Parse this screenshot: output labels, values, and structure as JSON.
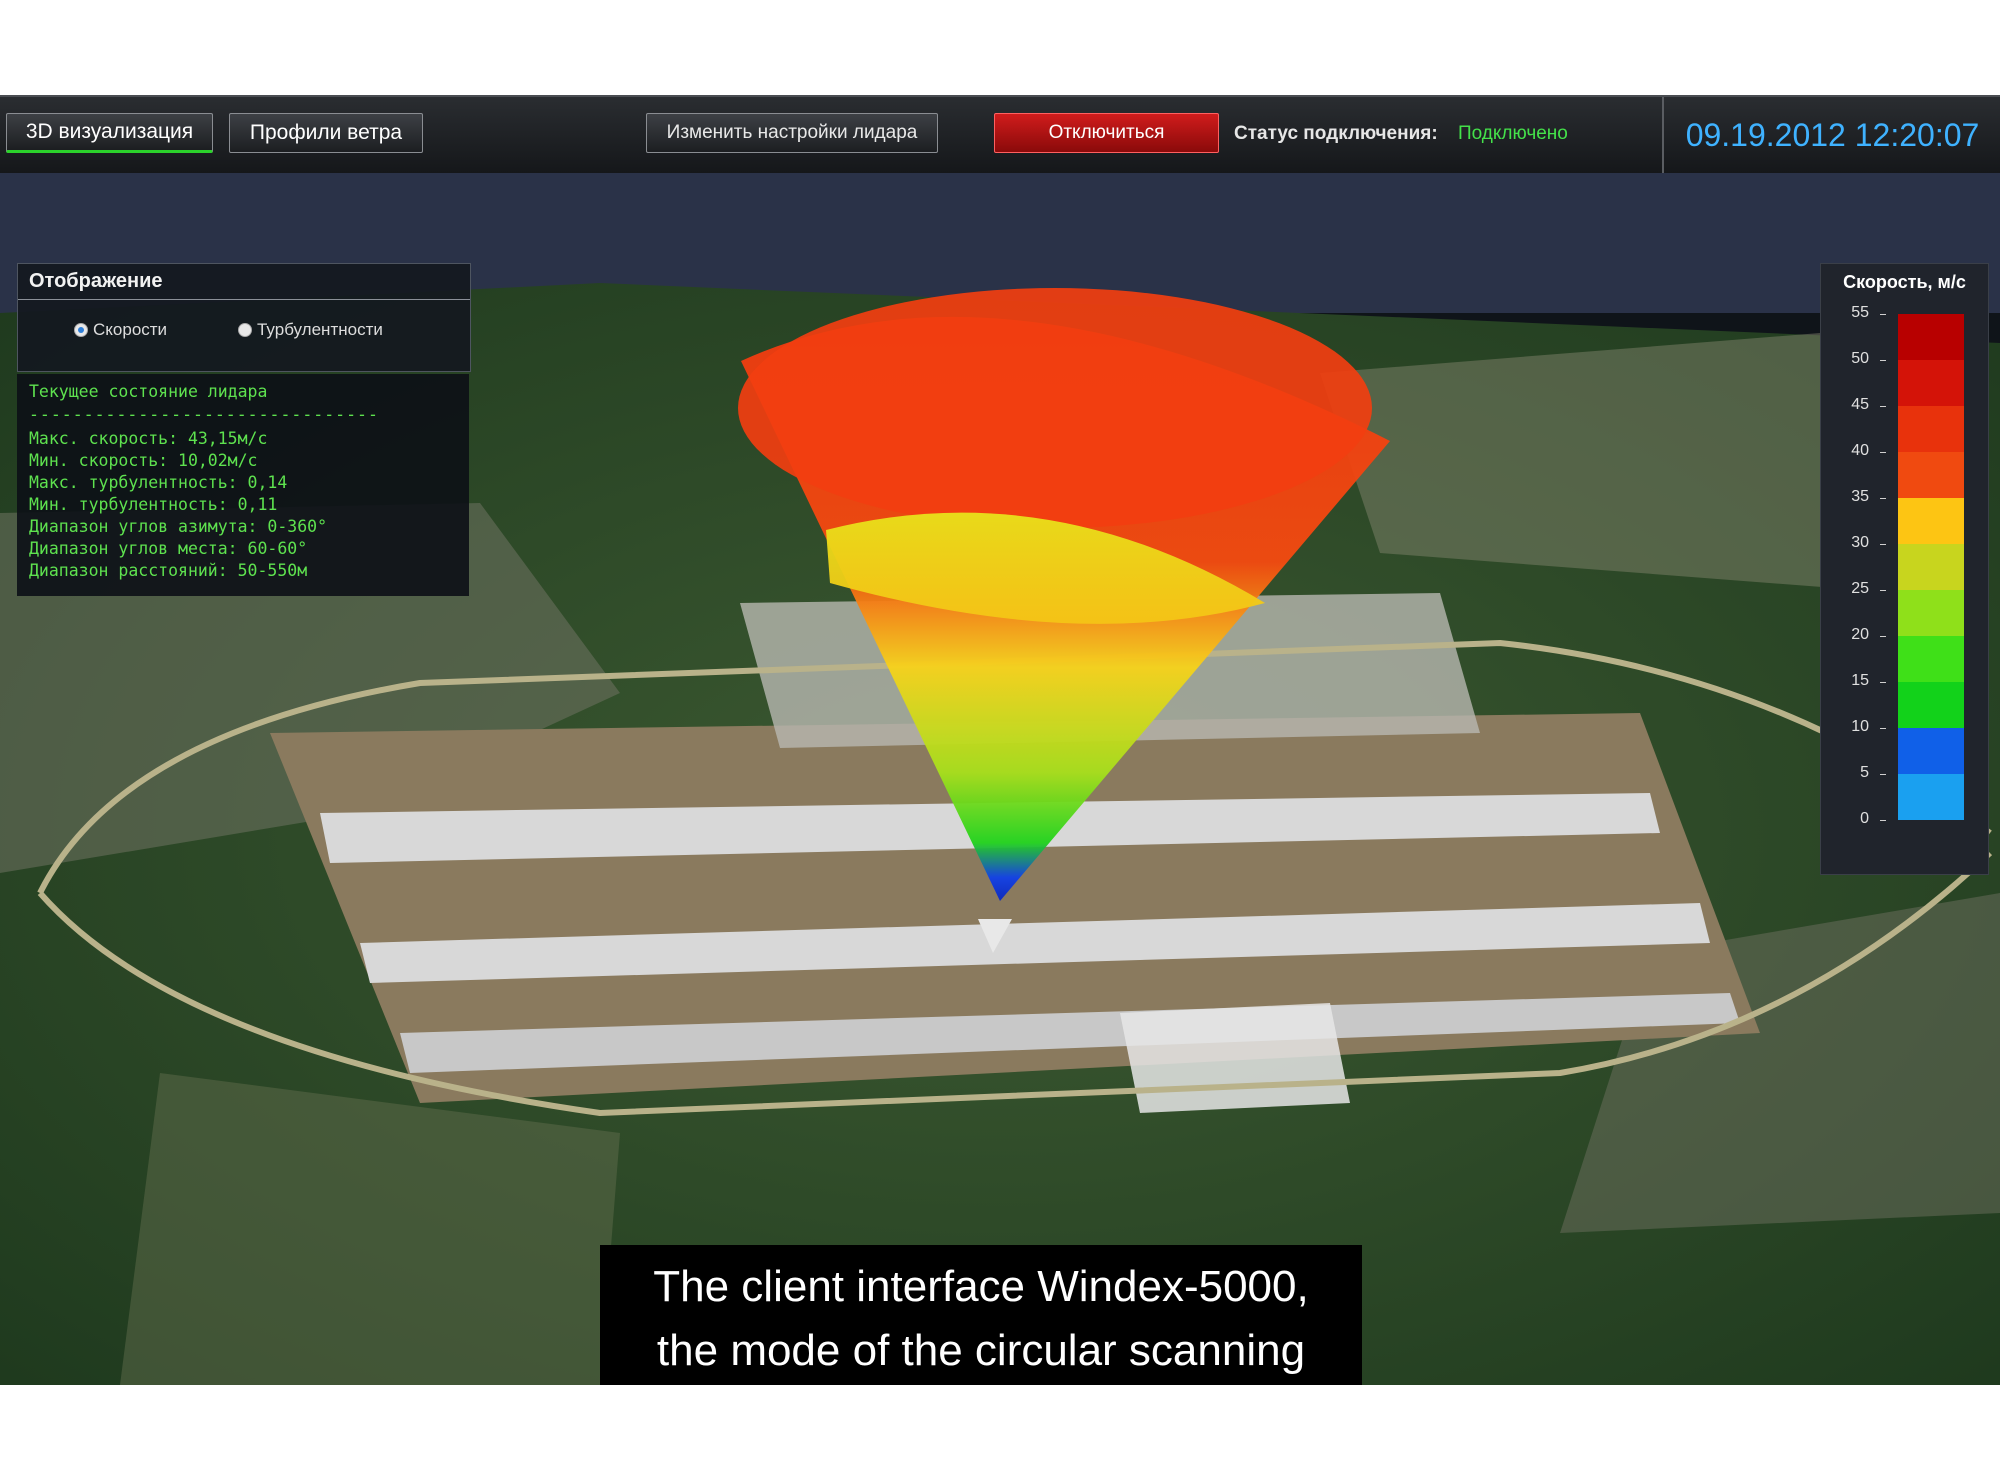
{
  "toolbar": {
    "tab_3d": "3D визуализация",
    "tab_profiles": "Профили ветра",
    "settings_button": "Изменить настройки лидара",
    "disconnect_button": "Отключиться",
    "status_label": "Статус подключения:",
    "status_value": "Подключено",
    "datetime": "09.19.2012 12:20:07"
  },
  "display_panel": {
    "title": "Отображение",
    "options": [
      {
        "label": "Скорости",
        "selected": true
      },
      {
        "label": "Турбулентности",
        "selected": false
      }
    ]
  },
  "lidar_status": {
    "title": "Текущее состояние лидара",
    "divider": "--------------------------------",
    "lines": [
      "Макс. скорость: 43,15м/с",
      "Мин. скорость: 10,02м/с",
      "Макс. турбулентность: 0,14",
      "Мин. турбулентность: 0,11",
      "Диапазон углов азимута: 0-360°",
      "Диапазон углов места: 60-60°",
      "Диапазон расстояний: 50-550м"
    ]
  },
  "legend": {
    "title": "Скорость, м/с",
    "ticks": [
      "55",
      "50",
      "45",
      "40",
      "35",
      "30",
      "25",
      "20",
      "15",
      "10",
      "5",
      "0"
    ],
    "colors": [
      "#b80000",
      "#d41308",
      "#e8320c",
      "#f04a10",
      "#fdc513",
      "#c8d51e",
      "#8fe01a",
      "#3fe018",
      "#12d21a",
      "#1060e8",
      "#1aa0f0"
    ]
  },
  "caption": {
    "line1": "The client interface Windex-5000,",
    "line2": "the mode of the circular scanning"
  },
  "colors": {
    "status_ok": "#44e14a",
    "clock": "#3fb2ff",
    "disconnect": "#c41414"
  }
}
